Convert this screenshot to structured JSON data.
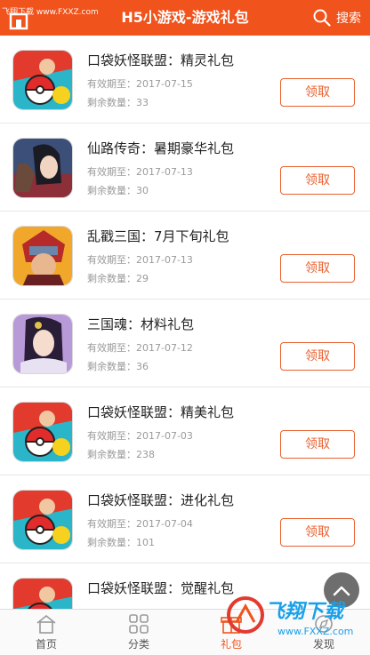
{
  "header": {
    "title": "H5小游戏-游戏礼包",
    "search_label": "搜索",
    "watermark": "飞翔下载 www.FXXZ.com"
  },
  "gifts": [
    {
      "name": "口袋妖怪联盟：精灵礼包",
      "date": "有效期至：2017-07-15",
      "remain": "剩余数量：33",
      "button": "领取",
      "icon": "pokemon-game-icon"
    },
    {
      "name": "仙路传奇：暑期豪华礼包",
      "date": "有效期至：2017-07-13",
      "remain": "剩余数量：30",
      "button": "领取",
      "icon": "xianlu-game-icon"
    },
    {
      "name": "乱戳三国：7月下旬礼包",
      "date": "有效期至：2017-07-13",
      "remain": "剩余数量：29",
      "button": "领取",
      "icon": "sanguo-warrior-icon"
    },
    {
      "name": "三国魂：材料礼包",
      "date": "有效期至：2017-07-12",
      "remain": "剩余数量：36",
      "button": "领取",
      "icon": "sanguohun-game-icon"
    },
    {
      "name": "口袋妖怪联盟：精美礼包",
      "date": "有效期至：2017-07-03",
      "remain": "剩余数量：238",
      "button": "领取",
      "icon": "pokemon-game-icon"
    },
    {
      "name": "口袋妖怪联盟：进化礼包",
      "date": "有效期至：2017-07-04",
      "remain": "剩余数量：101",
      "button": "领取",
      "icon": "pokemon-game-icon"
    },
    {
      "name": "口袋妖怪联盟：觉醒礼包",
      "date": "有效期至：2017-07-04",
      "remain": "",
      "button": "",
      "icon": "pokemon-game-icon"
    }
  ],
  "nav": [
    {
      "label": "首页",
      "icon": "home-icon"
    },
    {
      "label": "分类",
      "icon": "grid-icon"
    },
    {
      "label": "礼包",
      "icon": "gift-icon"
    },
    {
      "label": "发现",
      "icon": "discover-icon"
    }
  ],
  "corner_watermark": {
    "text": "飞翔下载",
    "url": "www.FXXZ.com"
  },
  "colors": {
    "brand": "#f0531c",
    "button": "#e9602f",
    "muted": "#9a9a9a"
  }
}
